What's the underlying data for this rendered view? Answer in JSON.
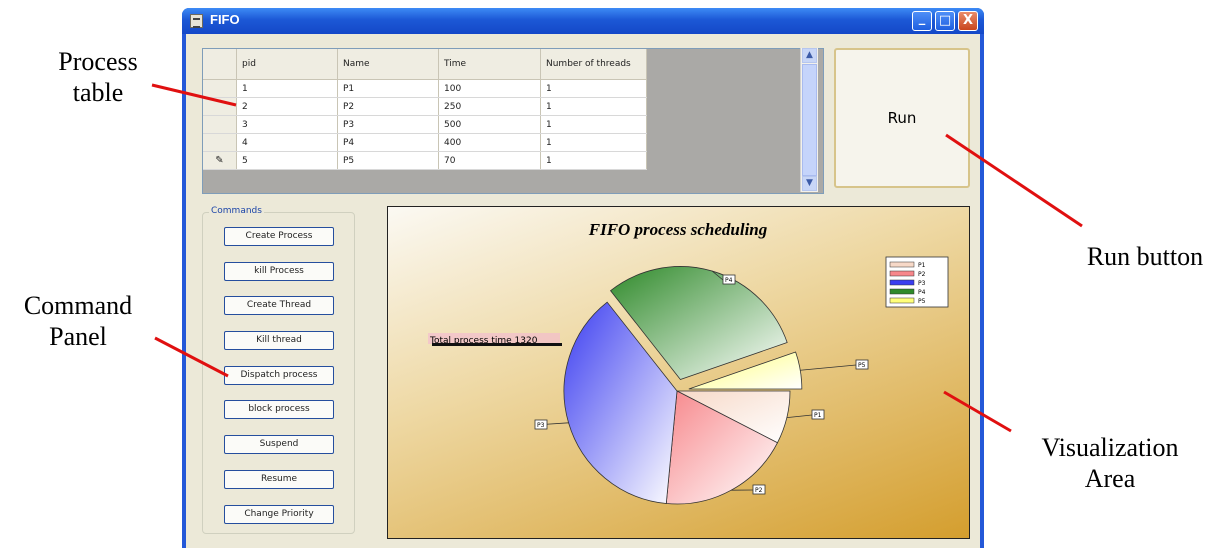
{
  "annotations": {
    "process_table": "Process\ntable",
    "command_panel": "Command\nPanel",
    "run_button": "Run button",
    "visualization_area": "Visualization\nArea"
  },
  "window": {
    "title": "FIFO",
    "controls": [
      "_",
      "□",
      "X"
    ]
  },
  "process_table": {
    "columns": [
      "pid",
      "Name",
      "Time",
      "Number of threads"
    ],
    "rows": [
      [
        "1",
        "P1",
        "100",
        "1"
      ],
      [
        "2",
        "P2",
        "250",
        "1"
      ],
      [
        "3",
        "P3",
        "500",
        "1"
      ],
      [
        "4",
        "P4",
        "400",
        "1"
      ],
      [
        "5",
        "P5",
        "70",
        "1"
      ]
    ],
    "current_row_marker": "✎"
  },
  "run_button": {
    "label": "Run"
  },
  "commands": {
    "title": "Commands",
    "buttons": [
      "Create Process",
      "kill Process",
      "Create Thread",
      "Kill thread",
      "Dispatch process",
      "block process",
      "Suspend",
      "Resume",
      "Change Priority"
    ]
  },
  "chart_data": {
    "type": "pie",
    "title": "FIFO process scheduling",
    "annotation": "Total process time 1320",
    "exploded": [
      "P4",
      "P5"
    ],
    "legend_position": "top-right",
    "slices": [
      {
        "name": "P1",
        "value": 100,
        "color": "#f7d9c8"
      },
      {
        "name": "P2",
        "value": 250,
        "color": "#f7878b"
      },
      {
        "name": "P3",
        "value": 500,
        "color": "#3b3df0"
      },
      {
        "name": "P4",
        "value": 400,
        "color": "#2f8a2a"
      },
      {
        "name": "P5",
        "value": 70,
        "color": "#ffff7a"
      }
    ]
  }
}
